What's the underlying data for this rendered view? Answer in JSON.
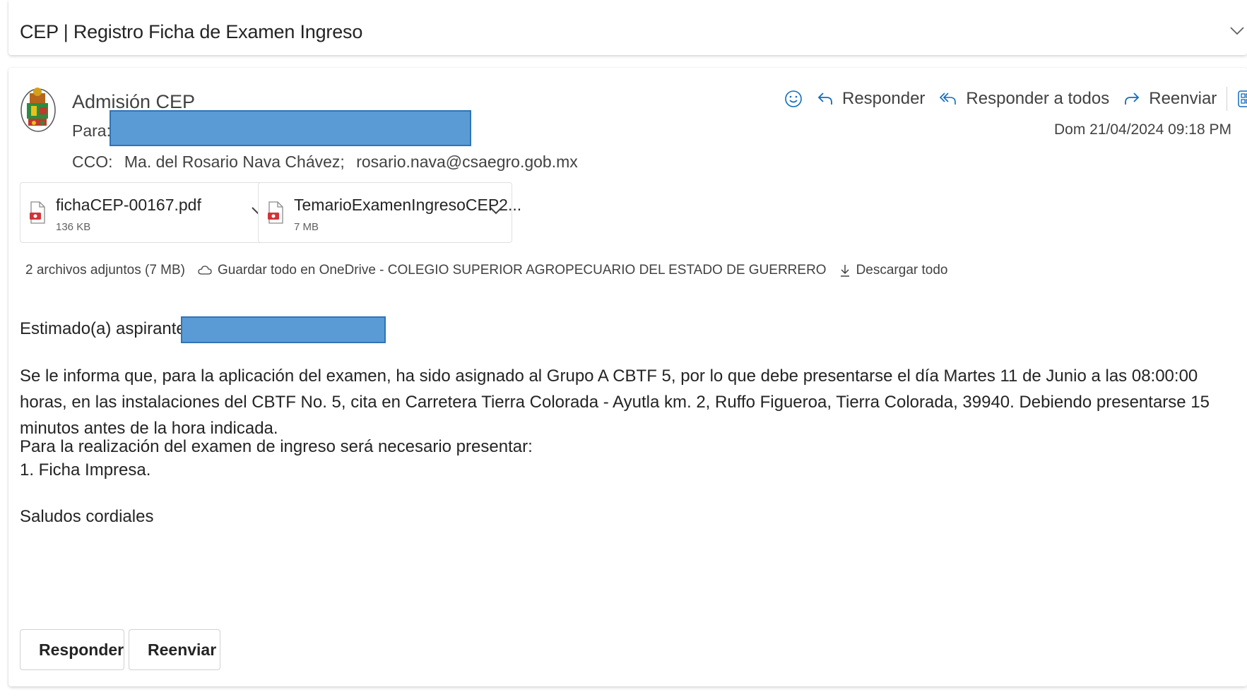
{
  "subject": "CEP | Registro Ficha de Examen Ingreso",
  "sender": {
    "name": "Admisión CEP",
    "to_label": "Para:",
    "cc_label": "CCO:",
    "cc_name": "Ma. del Rosario Nava Chávez;",
    "cc_email": "rosario.nava@csaegro.gob.mx"
  },
  "actions": {
    "reply": "Responder",
    "reply_all": "Responder a todos",
    "forward": "Reenviar"
  },
  "timestamp": "Dom 21/04/2024 09:18 PM",
  "attachments": [
    {
      "name": "fichaCEP-00167.pdf",
      "size": "136 KB"
    },
    {
      "name": "TemarioExamenIngresoCEP2...",
      "size": "7 MB"
    }
  ],
  "attachment_summary": {
    "count": "2 archivos adjuntos (7 MB)",
    "save": "Guardar todo en OneDrive - COLEGIO SUPERIOR AGROPECUARIO DEL ESTADO DE GUERRERO",
    "download": "Descargar todo"
  },
  "body": {
    "greeting": "Estimado(a) aspirante:",
    "paragraph1": "Se le informa que, para la aplicación del examen, ha sido asignado al Grupo A CBTF 5, por lo que debe presentarse el día Martes 11 de Junio a las 08:00:00 horas, en las instalaciones del CBTF No. 5, cita en Carretera Tierra Colorada - Ayutla km. 2, Ruffo Figueroa, Tierra Colorada, 39940. Debiendo presentarse 15 minutos antes de la hora indicada.",
    "paragraph2_line1": "Para la realización del examen de ingreso será necesario presentar:",
    "paragraph2_line2": "1. Ficha Impresa.",
    "closing": "Saludos cordiales"
  },
  "footer": {
    "reply": "Responder",
    "forward": "Reenviar"
  },
  "colors": {
    "accent": "#0f6cbd",
    "redaction": "#5b9bd5",
    "pdf_red": "#d13438"
  }
}
